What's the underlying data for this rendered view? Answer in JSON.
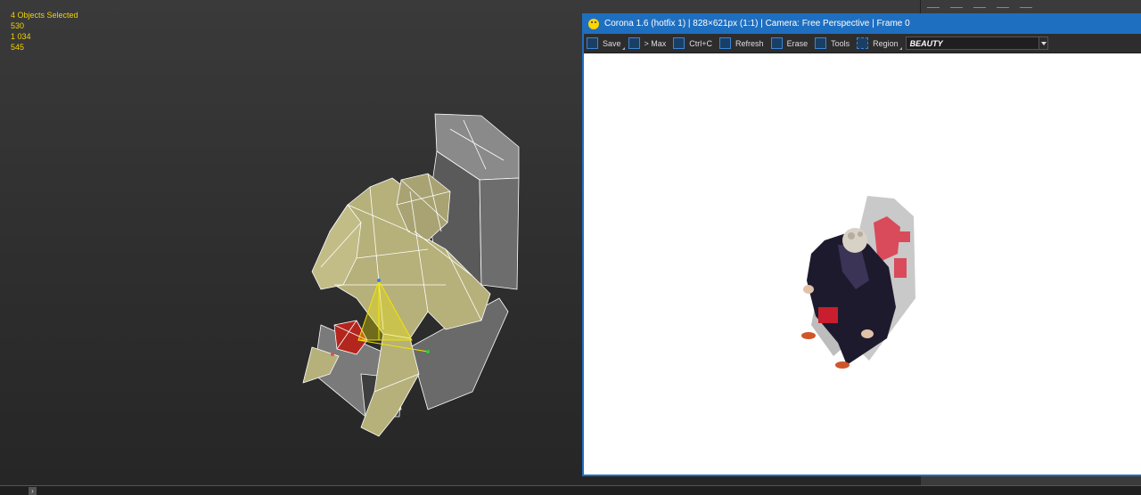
{
  "viewport": {
    "stats": [
      "4 Objects Selected",
      "530",
      "1 034",
      "545"
    ]
  },
  "render_window": {
    "title": "Corona 1.6 (hotfix 1) | 828×621px (1:1) | Camera: Free Perspective | Frame 0",
    "toolbar": [
      {
        "label": "Save",
        "icon": "save-icon"
      },
      {
        "label": "> Max",
        "icon": "max-icon"
      },
      {
        "label": "Ctrl+C",
        "icon": "copy-icon"
      },
      {
        "label": "Refresh",
        "icon": "refresh-icon"
      },
      {
        "label": "Erase",
        "icon": "erase-icon"
      },
      {
        "label": "Tools",
        "icon": "gear-icon"
      },
      {
        "label": "Region",
        "icon": "region-icon"
      }
    ],
    "render_element": "BEAUTY"
  },
  "colors": {
    "accent": "#1f6fc0",
    "stats_text": "#f2d200",
    "wire_mesh": "#b6b07a",
    "selection_red": "#b3261e"
  }
}
